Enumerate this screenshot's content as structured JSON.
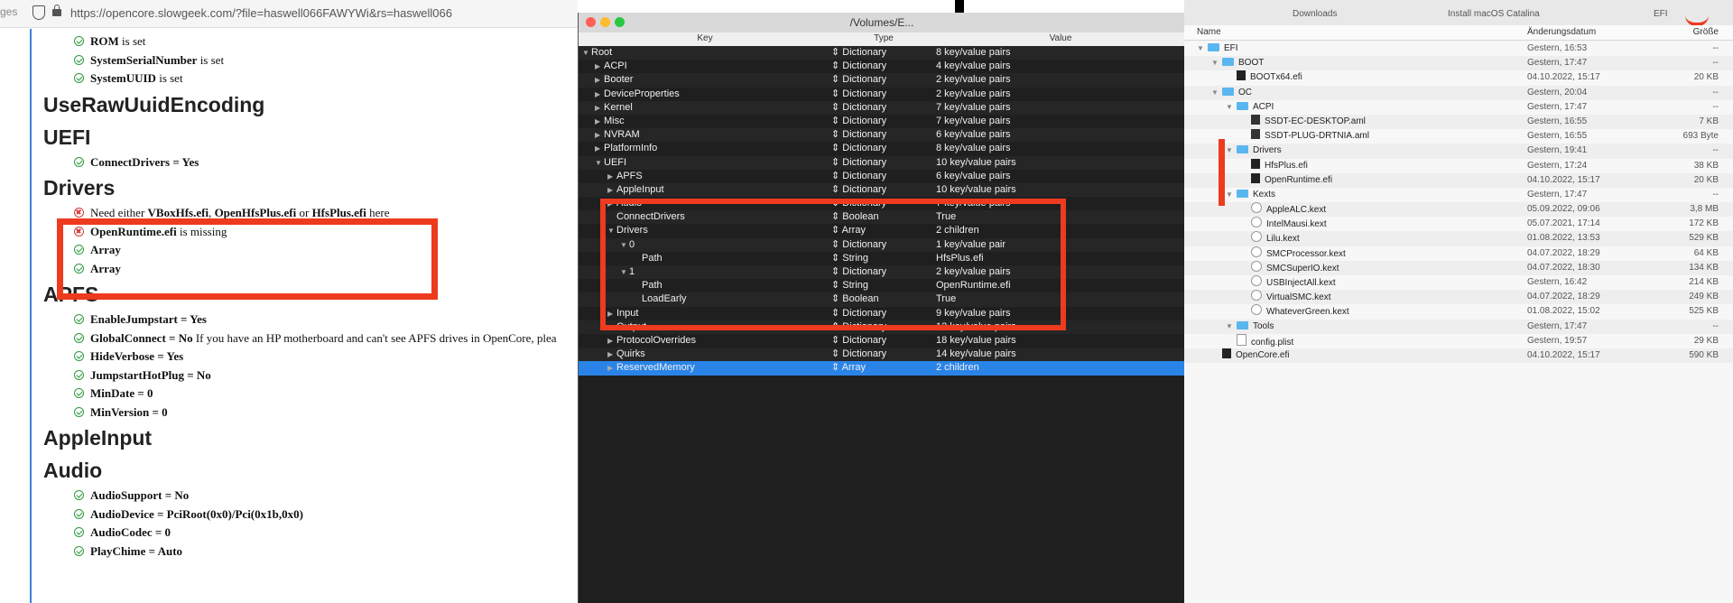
{
  "browser": {
    "edge_text": "ges",
    "url": "https://opencore.slowgeek.com/?file=haswell066FAWYWi&rs=haswell066",
    "sections": [
      {
        "type": "items",
        "items": [
          {
            "status": "ok",
            "bold": "ROM",
            "rest": " is set"
          },
          {
            "status": "ok",
            "bold": "SystemSerialNumber",
            "rest": " is set"
          },
          {
            "status": "ok",
            "bold": "SystemUUID",
            "rest": " is set"
          }
        ]
      },
      {
        "type": "heading",
        "text": "UseRawUuidEncoding"
      },
      {
        "type": "heading",
        "text": "UEFI"
      },
      {
        "type": "items",
        "items": [
          {
            "status": "ok",
            "bold": "ConnectDrivers = Yes",
            "rest": ""
          }
        ]
      },
      {
        "type": "heading",
        "text": "Drivers"
      },
      {
        "type": "items",
        "items": [
          {
            "status": "err",
            "bold": "",
            "rest": "Need either ",
            "extra": [
              [
                "b",
                "VBoxHfs.efi"
              ],
              [
                "t",
                ", "
              ],
              [
                "b",
                "OpenHfsPlus.efi"
              ],
              [
                "t",
                " or "
              ],
              [
                "b",
                "HfsPlus.efi"
              ],
              [
                "t",
                " here"
              ]
            ]
          },
          {
            "status": "err",
            "bold": "OpenRuntime.efi",
            "rest": " is missing"
          },
          {
            "status": "ok",
            "bold": "Array",
            "rest": ""
          },
          {
            "status": "ok",
            "bold": "Array",
            "rest": ""
          }
        ]
      },
      {
        "type": "heading",
        "text": "APFS"
      },
      {
        "type": "items",
        "items": [
          {
            "status": "ok",
            "bold": "EnableJumpstart = Yes",
            "rest": ""
          },
          {
            "status": "ok",
            "bold": "GlobalConnect = No",
            "rest": " If you have an HP motherboard and can't see APFS drives in OpenCore, plea"
          },
          {
            "status": "ok",
            "bold": "HideVerbose = Yes",
            "rest": ""
          },
          {
            "status": "ok",
            "bold": "JumpstartHotPlug = No",
            "rest": ""
          },
          {
            "status": "ok",
            "bold": "MinDate = 0",
            "rest": ""
          },
          {
            "status": "ok",
            "bold": "MinVersion = 0",
            "rest": ""
          }
        ]
      },
      {
        "type": "heading",
        "text": "AppleInput"
      },
      {
        "type": "heading",
        "text": "Audio"
      },
      {
        "type": "items",
        "items": [
          {
            "status": "ok",
            "bold": "AudioSupport = No",
            "rest": ""
          },
          {
            "status": "ok",
            "bold": "AudioDevice = PciRoot(0x0)/Pci(0x1b,0x0)",
            "rest": ""
          },
          {
            "status": "ok",
            "bold": "AudioCodec = 0",
            "rest": ""
          },
          {
            "status": "ok",
            "bold": "PlayChime = Auto",
            "rest": ""
          }
        ]
      }
    ]
  },
  "plist": {
    "title": "/Volumes/E...",
    "headers": {
      "key": "Key",
      "type": "Type",
      "value": "Value"
    },
    "rows": [
      {
        "indent": 0,
        "tri": "▼",
        "key": "Root",
        "type": "⇕ Dictionary",
        "value": "8 key/value pairs"
      },
      {
        "indent": 1,
        "tri": "▶",
        "key": "ACPI",
        "type": "⇕ Dictionary",
        "value": "4 key/value pairs"
      },
      {
        "indent": 1,
        "tri": "▶",
        "key": "Booter",
        "type": "⇕ Dictionary",
        "value": "2 key/value pairs"
      },
      {
        "indent": 1,
        "tri": "▶",
        "key": "DeviceProperties",
        "type": "⇕ Dictionary",
        "value": "2 key/value pairs"
      },
      {
        "indent": 1,
        "tri": "▶",
        "key": "Kernel",
        "type": "⇕ Dictionary",
        "value": "7 key/value pairs"
      },
      {
        "indent": 1,
        "tri": "▶",
        "key": "Misc",
        "type": "⇕ Dictionary",
        "value": "7 key/value pairs"
      },
      {
        "indent": 1,
        "tri": "▶",
        "key": "NVRAM",
        "type": "⇕ Dictionary",
        "value": "6 key/value pairs"
      },
      {
        "indent": 1,
        "tri": "▶",
        "key": "PlatformInfo",
        "type": "⇕ Dictionary",
        "value": "8 key/value pairs"
      },
      {
        "indent": 1,
        "tri": "▼",
        "key": "UEFI",
        "type": "⇕ Dictionary",
        "value": "10 key/value pairs"
      },
      {
        "indent": 2,
        "tri": "▶",
        "key": "APFS",
        "type": "⇕ Dictionary",
        "value": "6 key/value pairs"
      },
      {
        "indent": 2,
        "tri": "▶",
        "key": "AppleInput",
        "type": "⇕ Dictionary",
        "value": "10 key/value pairs"
      },
      {
        "indent": 2,
        "tri": "▶",
        "key": "Audio",
        "type": "⇕ Dictionary",
        "value": "7 key/value pairs"
      },
      {
        "indent": 2,
        "tri": "",
        "key": "ConnectDrivers",
        "type": "⇕ Boolean",
        "value": "True"
      },
      {
        "indent": 2,
        "tri": "▼",
        "key": "Drivers",
        "type": "⇕ Array",
        "value": "2 children"
      },
      {
        "indent": 3,
        "tri": "▼",
        "key": "0",
        "type": "⇕ Dictionary",
        "value": "1 key/value pair"
      },
      {
        "indent": 4,
        "tri": "",
        "key": "Path",
        "type": "⇕ String",
        "value": "HfsPlus.efi"
      },
      {
        "indent": 3,
        "tri": "▼",
        "key": "1",
        "type": "⇕ Dictionary",
        "value": "2 key/value pairs"
      },
      {
        "indent": 4,
        "tri": "",
        "key": "Path",
        "type": "⇕ String",
        "value": "OpenRuntime.efi"
      },
      {
        "indent": 4,
        "tri": "",
        "key": "LoadEarly",
        "type": "⇕ Boolean",
        "value": "True"
      },
      {
        "indent": 2,
        "tri": "▶",
        "key": "Input",
        "type": "⇕ Dictionary",
        "value": "9 key/value pairs"
      },
      {
        "indent": 2,
        "tri": "▶",
        "key": "Output",
        "type": "⇕ Dictionary",
        "value": "12 key/value pairs"
      },
      {
        "indent": 2,
        "tri": "▶",
        "key": "ProtocolOverrides",
        "type": "⇕ Dictionary",
        "value": "18 key/value pairs"
      },
      {
        "indent": 2,
        "tri": "▶",
        "key": "Quirks",
        "type": "⇕ Dictionary",
        "value": "14 key/value pairs"
      },
      {
        "indent": 2,
        "tri": "▶",
        "key": "ReservedMemory",
        "type": "⇕ Array",
        "value": "2 children",
        "selected": true
      }
    ]
  },
  "finder": {
    "tabs": [
      "Downloads",
      "Install macOS Catalina",
      "EFI"
    ],
    "headers": {
      "name": "Name",
      "date": "Änderungsdatum",
      "size": "Größe"
    },
    "rows": [
      {
        "indent": 0,
        "tri": "▼",
        "icon": "folder",
        "name": "EFI",
        "date": "Gestern, 16:53",
        "size": "--"
      },
      {
        "indent": 1,
        "tri": "▼",
        "icon": "folder",
        "name": "BOOT",
        "date": "Gestern, 17:47",
        "size": "--"
      },
      {
        "indent": 2,
        "tri": "",
        "icon": "file",
        "name": "BOOTx64.efi",
        "date": "04.10.2022, 15:17",
        "size": "20 KB"
      },
      {
        "indent": 1,
        "tri": "▼",
        "icon": "folder",
        "name": "OC",
        "date": "Gestern, 20:04",
        "size": "--"
      },
      {
        "indent": 2,
        "tri": "▼",
        "icon": "folder",
        "name": "ACPI",
        "date": "Gestern, 17:47",
        "size": "--"
      },
      {
        "indent": 3,
        "tri": "",
        "icon": "aml",
        "name": "SSDT-EC-DESKTOP.aml",
        "date": "Gestern, 16:55",
        "size": "7 KB"
      },
      {
        "indent": 3,
        "tri": "",
        "icon": "aml",
        "name": "SSDT-PLUG-DRTNIA.aml",
        "date": "Gestern, 16:55",
        "size": "693 Byte"
      },
      {
        "indent": 2,
        "tri": "▼",
        "icon": "folder",
        "name": "Drivers",
        "date": "Gestern, 19:41",
        "size": "--"
      },
      {
        "indent": 3,
        "tri": "",
        "icon": "file",
        "name": "HfsPlus.efi",
        "date": "Gestern, 17:24",
        "size": "38 KB"
      },
      {
        "indent": 3,
        "tri": "",
        "icon": "file",
        "name": "OpenRuntime.efi",
        "date": "04.10.2022, 15:17",
        "size": "20 KB"
      },
      {
        "indent": 2,
        "tri": "▼",
        "icon": "folder",
        "name": "Kexts",
        "date": "Gestern, 17:47",
        "size": "--"
      },
      {
        "indent": 3,
        "tri": "",
        "icon": "kext",
        "name": "AppleALC.kext",
        "date": "05.09.2022, 09:06",
        "size": "3,8 MB"
      },
      {
        "indent": 3,
        "tri": "",
        "icon": "kext",
        "name": "IntelMausi.kext",
        "date": "05.07.2021, 17:14",
        "size": "172 KB"
      },
      {
        "indent": 3,
        "tri": "",
        "icon": "kext",
        "name": "Lilu.kext",
        "date": "01.08.2022, 13:53",
        "size": "529 KB"
      },
      {
        "indent": 3,
        "tri": "",
        "icon": "kext",
        "name": "SMCProcessor.kext",
        "date": "04.07.2022, 18:29",
        "size": "64 KB"
      },
      {
        "indent": 3,
        "tri": "",
        "icon": "kext",
        "name": "SMCSuperIO.kext",
        "date": "04.07.2022, 18:30",
        "size": "134 KB"
      },
      {
        "indent": 3,
        "tri": "",
        "icon": "kext",
        "name": "USBInjectAll.kext",
        "date": "Gestern, 16:42",
        "size": "214 KB"
      },
      {
        "indent": 3,
        "tri": "",
        "icon": "kext",
        "name": "VirtualSMC.kext",
        "date": "04.07.2022, 18:29",
        "size": "249 KB"
      },
      {
        "indent": 3,
        "tri": "",
        "icon": "kext",
        "name": "WhateverGreen.kext",
        "date": "01.08.2022, 15:02",
        "size": "525 KB"
      },
      {
        "indent": 2,
        "tri": "▼",
        "icon": "folder",
        "name": "Tools",
        "date": "Gestern, 17:47",
        "size": "--"
      },
      {
        "indent": 2,
        "tri": "",
        "icon": "doc",
        "name": "config.plist",
        "date": "Gestern, 19:57",
        "size": "29 KB"
      },
      {
        "indent": 1,
        "tri": "",
        "icon": "file",
        "name": "OpenCore.efi",
        "date": "04.10.2022, 15:17",
        "size": "590 KB"
      }
    ]
  },
  "colors": {
    "highlight_red": "#ee3a1e",
    "selection_blue": "#2a84e8",
    "ok_green": "#2e9b3c",
    "error_red": "#d23a3a"
  }
}
